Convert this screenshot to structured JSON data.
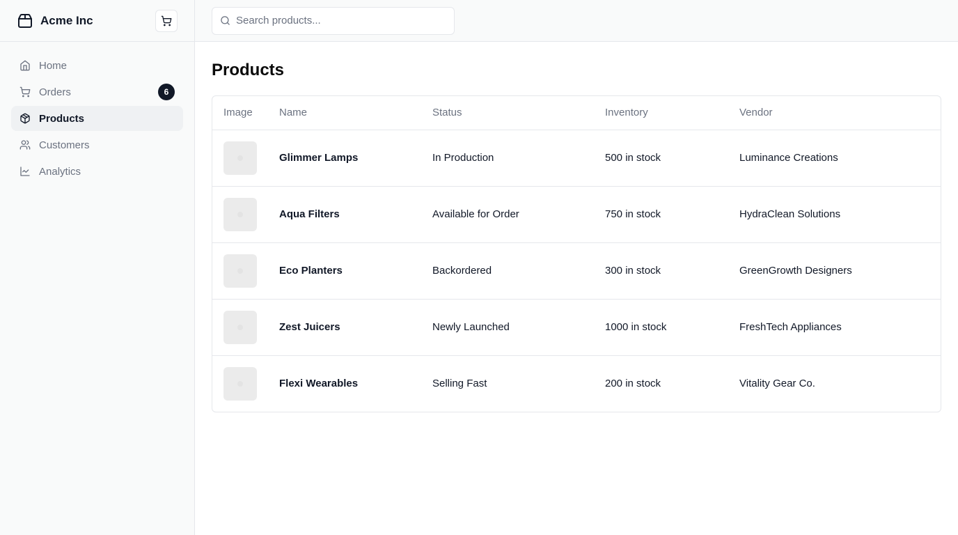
{
  "brand": {
    "name": "Acme Inc",
    "icon": "package-icon"
  },
  "cart_button": {
    "icon": "shopping-cart-icon"
  },
  "sidebar": {
    "items": [
      {
        "label": "Home",
        "icon": "home-icon",
        "active": false
      },
      {
        "label": "Orders",
        "icon": "shopping-cart-icon",
        "badge": "6",
        "active": false
      },
      {
        "label": "Products",
        "icon": "package-icon",
        "active": true
      },
      {
        "label": "Customers",
        "icon": "users-icon",
        "active": false
      },
      {
        "label": "Analytics",
        "icon": "line-chart-icon",
        "active": false
      }
    ]
  },
  "search": {
    "placeholder": "Search products...",
    "value": ""
  },
  "page": {
    "title": "Products"
  },
  "table": {
    "columns": [
      "Image",
      "Name",
      "Status",
      "Inventory",
      "Vendor"
    ],
    "rows": [
      {
        "name": "Glimmer Lamps",
        "status": "In Production",
        "inventory": "500 in stock",
        "vendor": "Luminance Creations"
      },
      {
        "name": "Aqua Filters",
        "status": "Available for Order",
        "inventory": "750 in stock",
        "vendor": "HydraClean Solutions"
      },
      {
        "name": "Eco Planters",
        "status": "Backordered",
        "inventory": "300 in stock",
        "vendor": "GreenGrowth Designers"
      },
      {
        "name": "Zest Juicers",
        "status": "Newly Launched",
        "inventory": "1000 in stock",
        "vendor": "FreshTech Appliances"
      },
      {
        "name": "Flexi Wearables",
        "status": "Selling Fast",
        "inventory": "200 in stock",
        "vendor": "Vitality Gear Co."
      }
    ]
  },
  "colors": {
    "sidebar_bg": "#f9fafa",
    "border": "#e5e7eb",
    "muted_text": "#6b7280",
    "active_bg": "#eff1f3",
    "badge_bg": "#111827"
  }
}
